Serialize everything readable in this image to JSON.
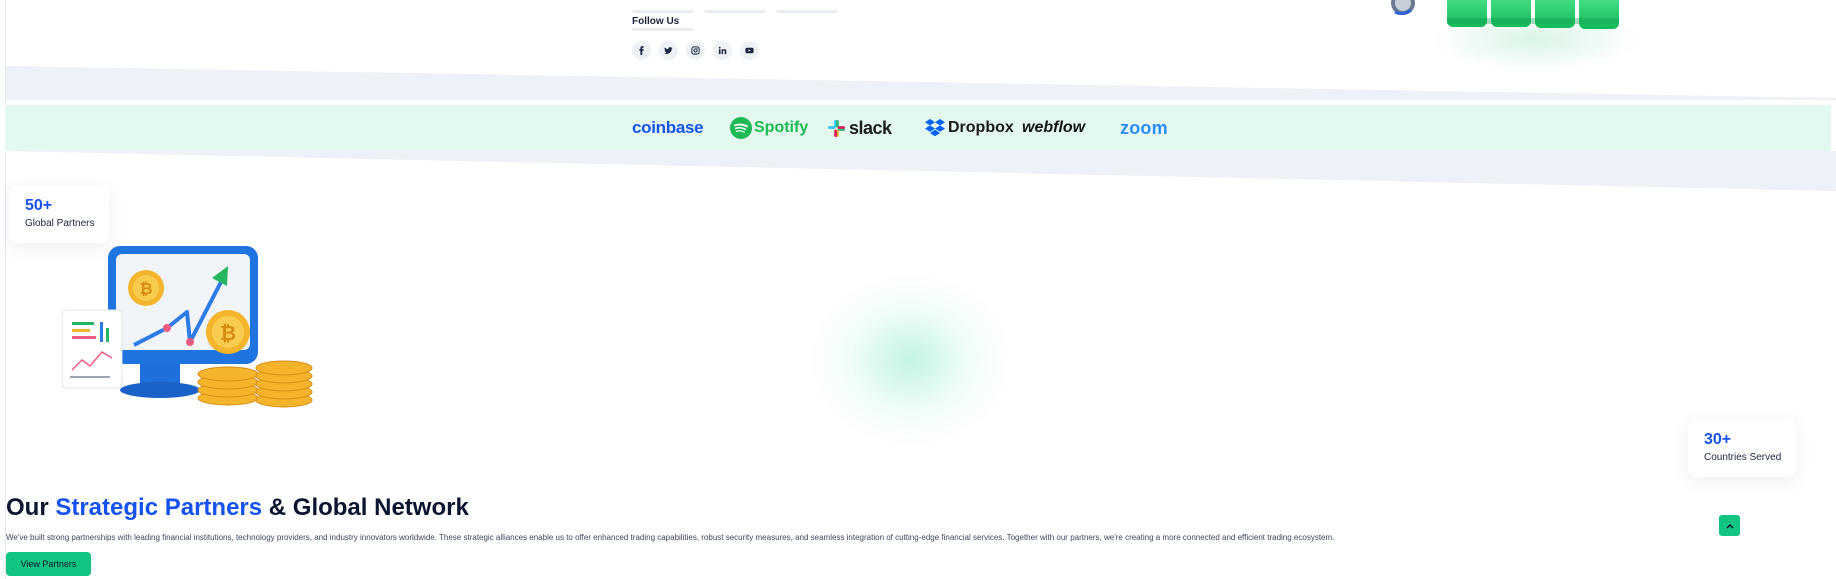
{
  "footer": {
    "follow_title": "Follow Us",
    "socials": [
      "facebook-icon",
      "twitter-icon",
      "instagram-icon",
      "linkedin-icon",
      "youtube-icon"
    ]
  },
  "partners_band": {
    "logos": [
      "coinbase",
      "Spotify",
      "slack",
      "Dropbox",
      "webflow",
      "zoom"
    ]
  },
  "stats": [
    {
      "value": "50+",
      "label": "Global Partners"
    },
    {
      "value": "30+",
      "label": "Countries Served"
    }
  ],
  "section": {
    "title_part1": "Our ",
    "title_highlight": "Strategic Partners",
    "title_part2": " & Global Network",
    "description": "We've built strong partnerships with leading financial institutions, technology providers, and industry innovators worldwide. These strategic alliances enable us to offer enhanced trading capabilities, robust security measures, and seamless integration of cutting-edge financial services. Together with our partners, we're creating a more connected and efficient trading ecosystem.",
    "button_label": "View Partners"
  },
  "colors": {
    "accent_blue": "#1652f0",
    "accent_green": "#12c481",
    "band_bg": "#e3f8ef"
  }
}
